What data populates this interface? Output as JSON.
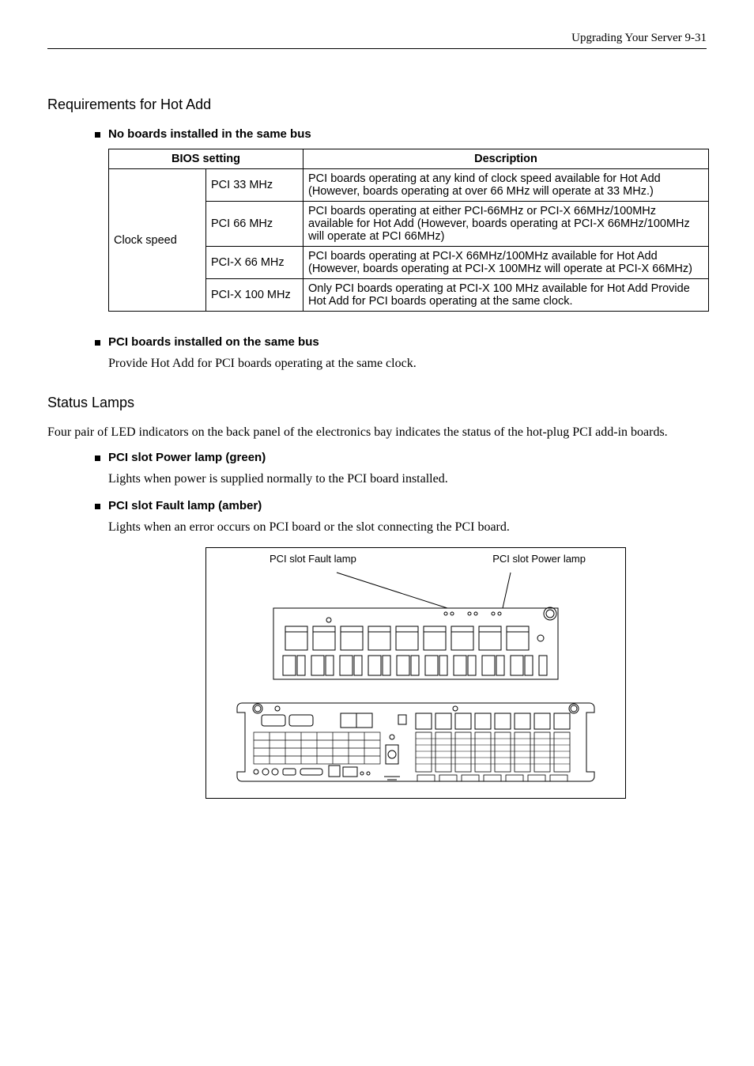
{
  "header": {
    "text": "Upgrading Your Server   9-31"
  },
  "section1": {
    "heading": "Requirements for Hot Add",
    "bullet1": "No boards installed in the same bus",
    "table": {
      "h1": "BIOS setting",
      "h2": "Description",
      "r0c0": "Clock speed",
      "rows": [
        {
          "c1": "PCI 33 MHz",
          "c2": "PCI boards operating at any kind of clock speed available for Hot Add (However, boards operating at over 66 MHz will operate at 33 MHz.)"
        },
        {
          "c1": "PCI 66 MHz",
          "c2": "PCI boards operating at either PCI-66MHz or PCI-X 66MHz/100MHz available for Hot Add (However, boards operating at PCI-X 66MHz/100MHz will operate at PCI 66MHz)"
        },
        {
          "c1": "PCI-X 66 MHz",
          "c2": "PCI boards operating at PCI-X 66MHz/100MHz available for Hot Add (However, boards operating at PCI-X 100MHz will operate at PCI-X 66MHz)"
        },
        {
          "c1": "PCI-X 100 MHz",
          "c2": "Only PCI boards operating at PCI-X 100 MHz available for Hot Add            Provide Hot Add for PCI boards operating at the same clock."
        }
      ]
    },
    "bullet2": "PCI boards installed on the same bus",
    "bullet2_text": "Provide Hot Add for PCI boards operating at the same clock."
  },
  "section2": {
    "heading": "Status Lamps",
    "intro": "Four pair of LED indicators on the back panel of the electronics bay indicates the status of the hot-plug PCI add-in boards.",
    "b1": "PCI slot Power lamp (green)",
    "b1_text": "Lights when power is supplied normally to the PCI board installed.",
    "b2": "PCI slot Fault lamp (amber)",
    "b2_text": "Lights when an error occurs on PCI board or the slot connecting the PCI board.",
    "fig": {
      "left": "PCI slot Fault lamp",
      "right": "PCI slot Power lamp"
    }
  }
}
